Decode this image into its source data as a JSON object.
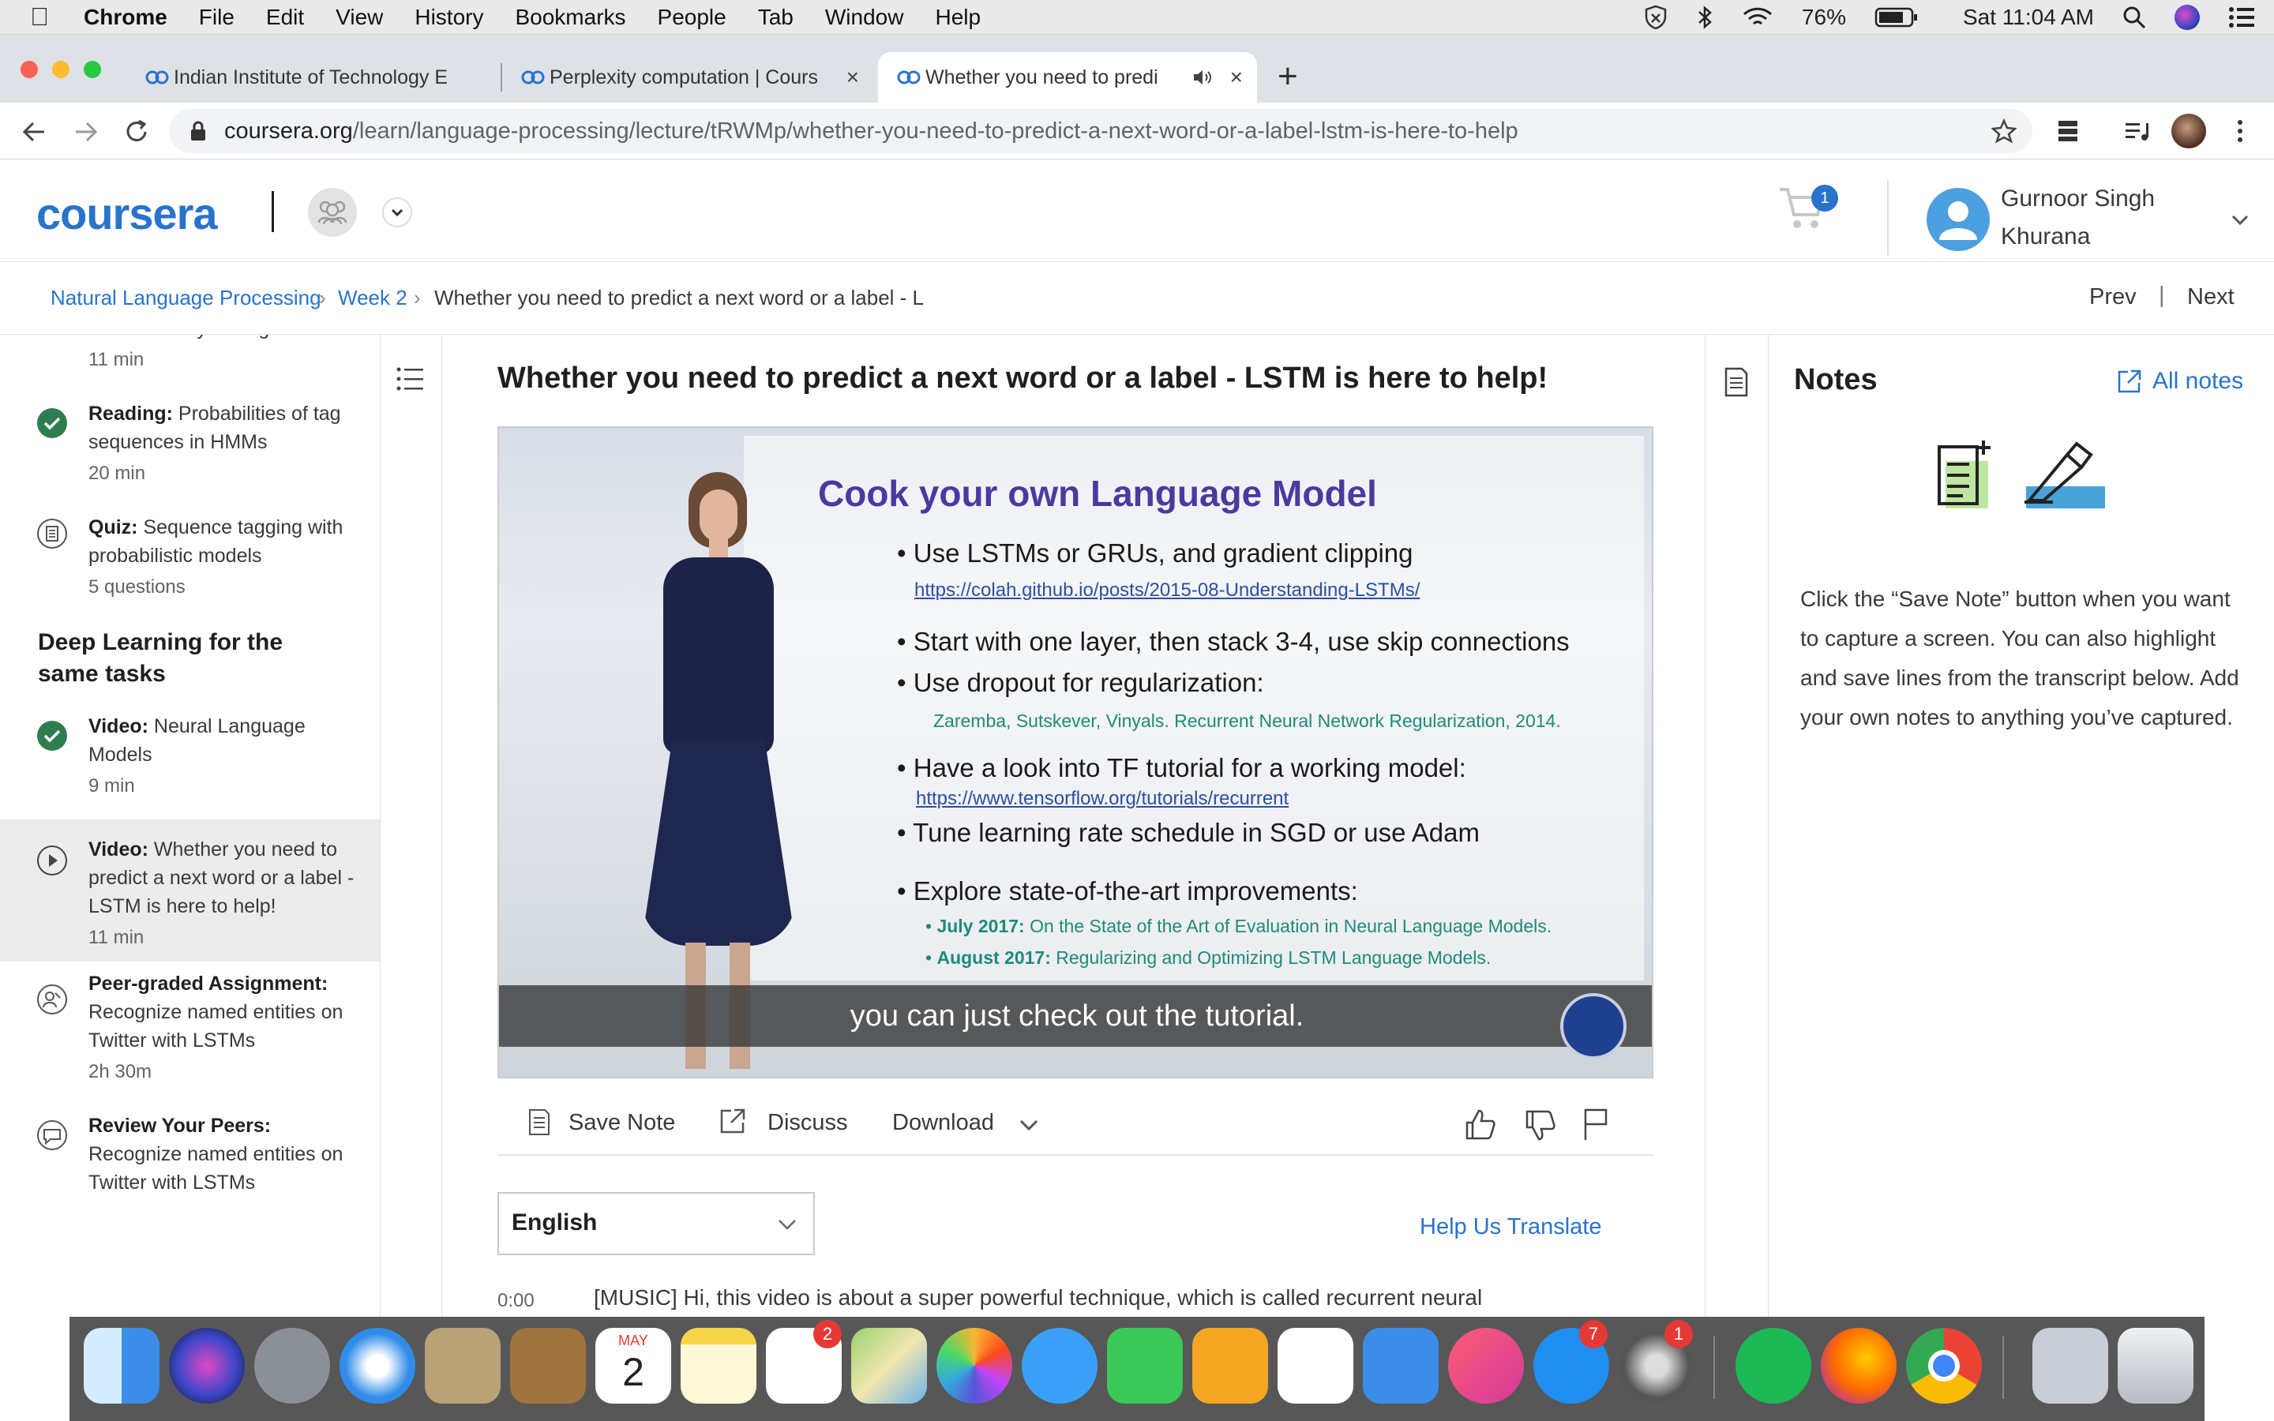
{
  "menubar": {
    "items": [
      "Chrome",
      "File",
      "Edit",
      "View",
      "History",
      "Bookmarks",
      "People",
      "Tab",
      "Window",
      "Help"
    ],
    "battery": "76%",
    "clock": "Sat 11:04 AM"
  },
  "tabs": [
    {
      "title": "Indian Institute of Technology E"
    },
    {
      "title": "Perplexity computation | Cours"
    },
    {
      "title": "Whether you need to predi"
    }
  ],
  "address": {
    "host": "coursera.org",
    "path": "/learn/language-processing/lecture/tRWMp/whether-you-need-to-predict-a-next-word-or-a-label-lstm-is-here-to-help"
  },
  "header": {
    "logo": "coursera",
    "cart_count": "1",
    "user_first": "Gurnoor Singh",
    "user_last": "Khurana"
  },
  "breadcrumb": {
    "course": "Natural Language Processing",
    "week": "Week 2",
    "lecture": "Whether you need to predict a next word or a label - L",
    "prev": "Prev",
    "next": "Next"
  },
  "sidebar": {
    "top_partial": {
      "label": "Named Entity Recognition",
      "meta": "11 min"
    },
    "items": [
      {
        "type": "Reading:",
        "label": "Probabilities of tag sequences in HMMs",
        "meta": "20 min"
      },
      {
        "type": "Quiz:",
        "label": "Sequence tagging with probabilistic models",
        "meta": "5 questions"
      },
      {
        "type": "Video:",
        "label": "Neural Language Models",
        "meta": "9 min"
      },
      {
        "type": "Video:",
        "label": "Whether you need to predict a next word or a label - LSTM is here to help!",
        "meta": "11 min"
      },
      {
        "type": "Peer-graded Assignment:",
        "label": "Recognize named entities on Twitter with LSTMs",
        "meta": "2h 30m"
      },
      {
        "type": "Review Your Peers:",
        "label": "Recognize named entities on Twitter with LSTMs",
        "meta": ""
      }
    ],
    "section_heading": "Deep Learning for the same tasks"
  },
  "main": {
    "title": "Whether you need to predict a next word or a label - LSTM is here to help!",
    "slide": {
      "heading": "Cook your own Language Model",
      "b1": "Use LSTMs or GRUs, and gradient clipping",
      "l1": "https://colah.github.io/posts/2015-08-Understanding-LSTMs/",
      "b2": "Start with one layer, then stack 3-4, use skip connections",
      "b3": "Use dropout for regularization:",
      "r3": "Zaremba, Sutskever, Vinyals. Recurrent Neural Network Regularization, 2014.",
      "b4": "Have a look into TF tutorial for a working model:",
      "l4": "https://www.tensorflow.org/tutorials/recurrent",
      "b5": "Tune learning rate schedule in SGD or use Adam",
      "b6": "Explore state-of-the-art improvements:",
      "s1_date": "July 2017:",
      "s1_text": "On the State of the Art of Evaluation in Neural Language Models.",
      "s2_date": "August 2017:",
      "s2_text": "Regularizing and Optimizing LSTM Language Models."
    },
    "caption": "you can just check out the tutorial.",
    "actions": {
      "save_note": "Save Note",
      "discuss": "Discuss",
      "download": "Download"
    },
    "language": "English",
    "help_translate": "Help Us Translate",
    "transcript": {
      "time": "0:00",
      "text": "[MUSIC] Hi, this video is about a super powerful technique, which is called recurrent neural"
    }
  },
  "notes": {
    "title": "Notes",
    "all_notes": "All notes",
    "description": "Click the “Save Note” button when you want to capture a screen. You can also highlight and save lines from the transcript below. Add your own notes to anything you’ve captured."
  },
  "dock": {
    "badges": {
      "reminders": "2",
      "appstore": "7",
      "settings": "1"
    },
    "calendar_month": "MAY",
    "calendar_day": "2"
  },
  "colors": {
    "accent": "#2a73cc",
    "complete": "#2e7d4f",
    "slide_title": "#4a3aa0",
    "slide_sub": "#1e8a7a"
  }
}
